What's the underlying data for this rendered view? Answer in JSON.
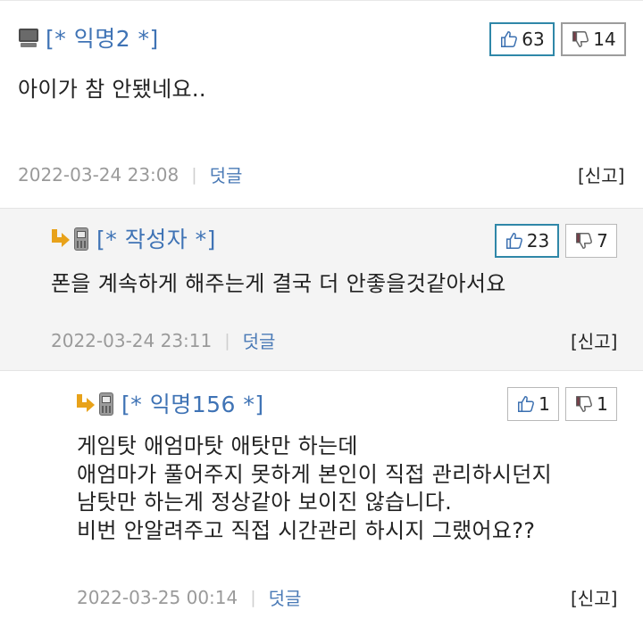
{
  "comments": [
    {
      "author": "[* 익명2 *]",
      "author_icon": "pc-icon",
      "likes": "63",
      "dislikes": "14",
      "lines": [
        "아이가 참 안됐네요.."
      ],
      "date": "2022-03-24 23:08",
      "reply_label": "덧글",
      "report_label": "[신고]"
    },
    {
      "author": "[* 작성자 *]",
      "author_icon": "mobile-phone-icon",
      "likes": "23",
      "dislikes": "7",
      "lines": [
        "폰을 계속하게 해주는게 결국 더 안좋을것같아서요"
      ],
      "date": "2022-03-24 23:11",
      "reply_label": "덧글",
      "report_label": "[신고]"
    },
    {
      "author": "[* 익명156 *]",
      "author_icon": "mobile-phone-icon",
      "likes": "1",
      "dislikes": "1",
      "lines": [
        "게임탓 애엄마탓 애탓만 하는데",
        "애엄마가 풀어주지 못하게 본인이 직접 관리하시던지",
        "남탓만 하는게 정상같아 보이진 않습니다.",
        "비번 안알려주고 직접 시간관리 하시지 그랬어요??"
      ],
      "date": "2022-03-25 00:14",
      "reply_label": "덧글",
      "report_label": "[신고]"
    }
  ],
  "colors": {
    "author_link": "#3f73b5",
    "reply_arrow": "#e8a21a",
    "like_border": "#2f87a8",
    "dislike_thumb": "#7a3b45"
  }
}
